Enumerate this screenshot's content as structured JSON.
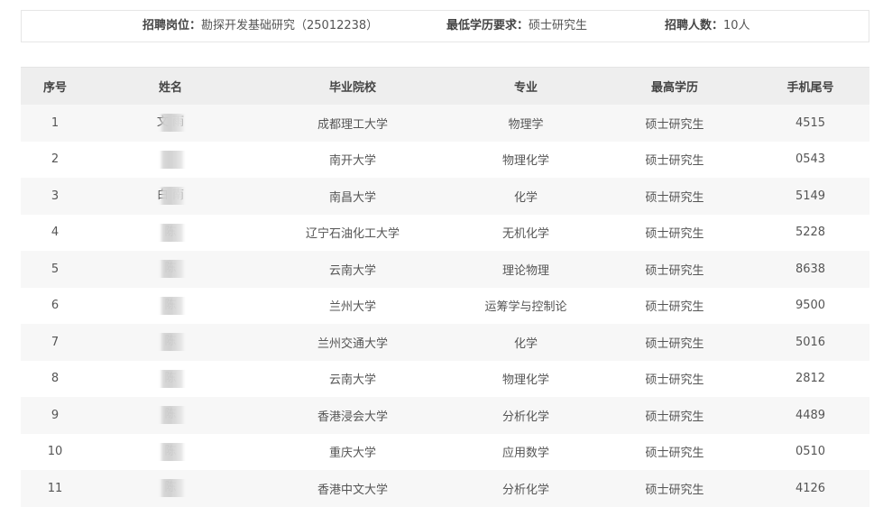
{
  "info": {
    "post_label": "招聘岗位：",
    "post_value": "勘探开发基础研究（25012238）",
    "edu_label": "最低学历要求：",
    "edu_value": "硕士研究生",
    "count_label": "招聘人数：",
    "count_value": "10人"
  },
  "table": {
    "headers": [
      "序号",
      "姓名",
      "毕业院校",
      "专业",
      "最高学历",
      "手机尾号"
    ],
    "rows": [
      {
        "no": "1",
        "name": "文 雨",
        "school": "成都理工大学",
        "major": "物理学",
        "degree": "硕士研究生",
        "phone": "4515"
      },
      {
        "no": "2",
        "name": "",
        "school": "南开大学",
        "major": "物理化学",
        "degree": "硕士研究生",
        "phone": "0543"
      },
      {
        "no": "3",
        "name": "白 南",
        "school": "南昌大学",
        "major": "化学",
        "degree": "硕士研究生",
        "phone": "5149"
      },
      {
        "no": "4",
        "name": "陈",
        "school": "辽宁石油化工大学",
        "major": "无机化学",
        "degree": "硕士研究生",
        "phone": "5228"
      },
      {
        "no": "5",
        "name": "陈",
        "school": "云南大学",
        "major": "理论物理",
        "degree": "硕士研究生",
        "phone": "8638"
      },
      {
        "no": "6",
        "name": "陈",
        "school": "兰州大学",
        "major": "运筹学与控制论",
        "degree": "硕士研究生",
        "phone": "9500"
      },
      {
        "no": "7",
        "name": "陈",
        "school": "兰州交通大学",
        "major": "化学",
        "degree": "硕士研究生",
        "phone": "5016"
      },
      {
        "no": "8",
        "name": "陈",
        "school": "云南大学",
        "major": "物理化学",
        "degree": "硕士研究生",
        "phone": "2812"
      },
      {
        "no": "9",
        "name": "陈",
        "school": "香港浸会大学",
        "major": "分析化学",
        "degree": "硕士研究生",
        "phone": "4489"
      },
      {
        "no": "10",
        "name": "陈",
        "school": "重庆大学",
        "major": "应用数学",
        "degree": "硕士研究生",
        "phone": "0510"
      },
      {
        "no": "11",
        "name": "陈",
        "school": "香港中文大学",
        "major": "分析化学",
        "degree": "硕士研究生",
        "phone": "4126"
      }
    ]
  }
}
